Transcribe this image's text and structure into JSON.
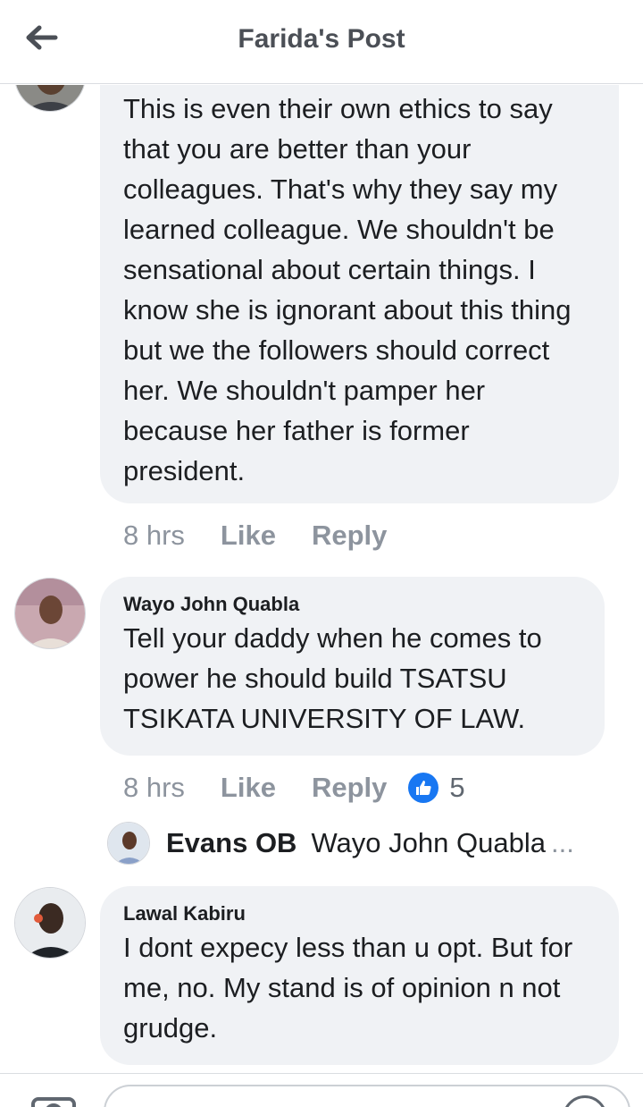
{
  "header": {
    "title": "Farida's Post"
  },
  "comments": [
    {
      "text": "This is even their own ethics to say that you are better than your colleagues. That's why they say my learned colleague. We shouldn't be sensational about certain things. I know she is ignorant about this thing but we the followers should correct her. We shouldn't pamper her because her father is former president.",
      "time": "8 hrs",
      "like_label": "Like",
      "reply_label": "Reply"
    },
    {
      "author": "Wayo John Quabla",
      "text": "Tell your daddy when he comes to power he should build TSATSU TSIKATA UNIVERSITY OF LAW.",
      "time": "8 hrs",
      "like_label": "Like",
      "reply_label": "Reply",
      "reaction_icon": "like-icon",
      "reaction_count": "5",
      "reply_preview": {
        "author": "Evans OB",
        "text": "Wayo John Quabla",
        "ellipsis": "..."
      }
    },
    {
      "author": "Lawal Kabiru",
      "text": "I dont expecy less than u opt. But for me, no. My stand is of opinion n not grudge."
    }
  ],
  "colors": {
    "accent": "#1877f2",
    "bubble": "#f0f2f5",
    "muted": "#8d949e"
  }
}
